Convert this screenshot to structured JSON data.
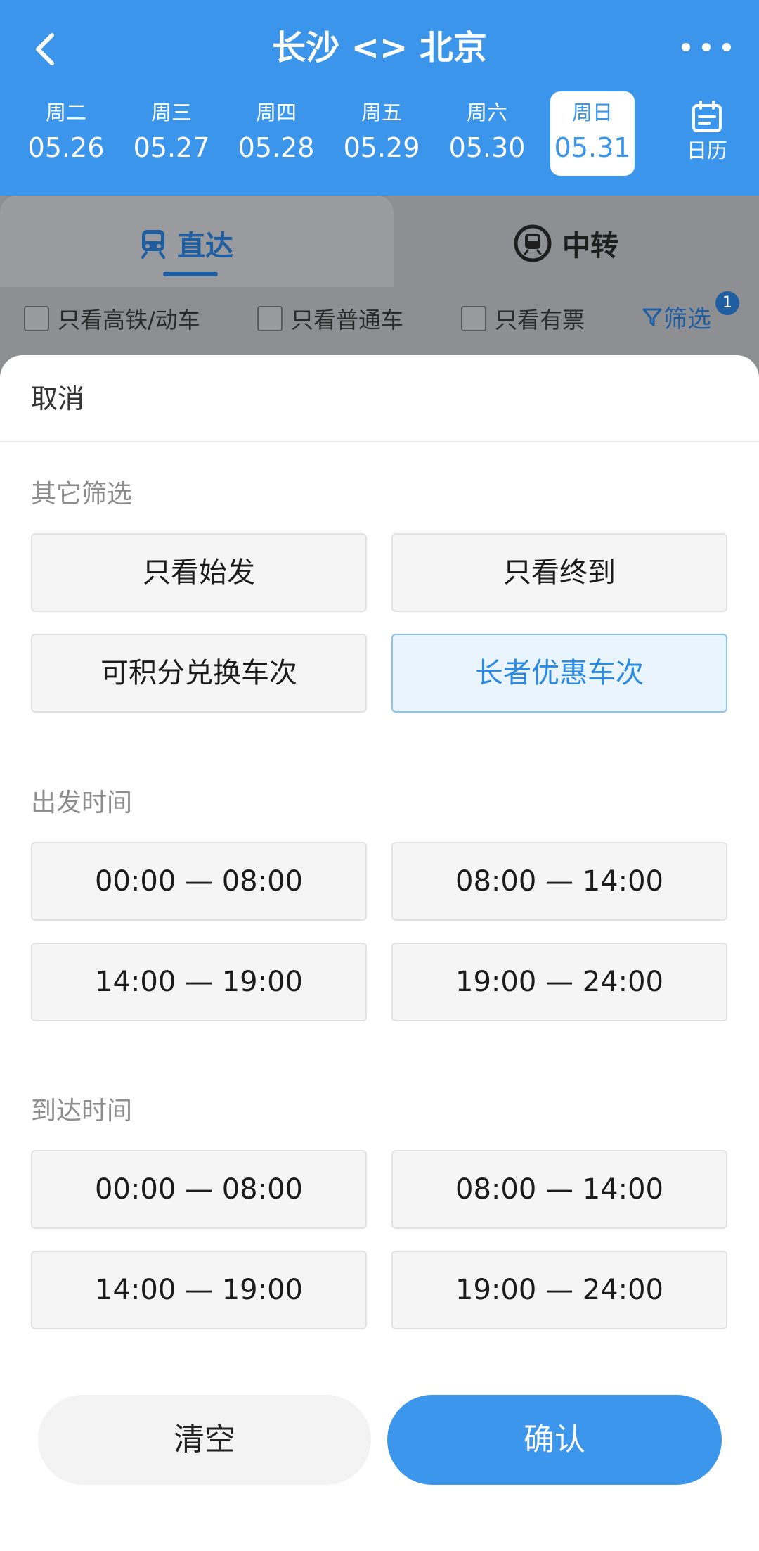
{
  "header": {
    "title": "长沙 <> 北京",
    "dates": [
      {
        "weekday": "周二",
        "date": "05.26"
      },
      {
        "weekday": "周三",
        "date": "05.27"
      },
      {
        "weekday": "周四",
        "date": "05.28"
      },
      {
        "weekday": "周五",
        "date": "05.29"
      },
      {
        "weekday": "周六",
        "date": "05.30"
      },
      {
        "weekday": "周日",
        "date": "05.31"
      }
    ],
    "selected_date": "05.31",
    "calendar_label": "日历"
  },
  "tabs": {
    "direct": "直达",
    "transfer": "中转",
    "active": "直达"
  },
  "filters": {
    "high_speed": "只看高铁/动车",
    "regular": "只看普通车",
    "available": "只看有票",
    "screen": "筛选",
    "screen_badge": "1"
  },
  "sheet": {
    "cancel": "取消",
    "other_title": "其它筛选",
    "other_options": [
      "只看始发",
      "只看终到",
      "可积分兑换车次",
      "长者优惠车次"
    ],
    "other_selected": "长者优惠车次",
    "depart_title": "出发时间",
    "depart_options": [
      "00:00 — 08:00",
      "08:00 — 14:00",
      "14:00 — 19:00",
      "19:00 — 24:00"
    ],
    "arrive_title": "到达时间",
    "arrive_options": [
      "00:00 — 08:00",
      "08:00 — 14:00",
      "14:00 — 19:00",
      "19:00 — 24:00"
    ],
    "clear": "清空",
    "confirm": "确认"
  },
  "colors": {
    "brand": "#3a95eb",
    "selected_text": "#2b8ae3",
    "overlay_link": "#1f5ea0"
  }
}
